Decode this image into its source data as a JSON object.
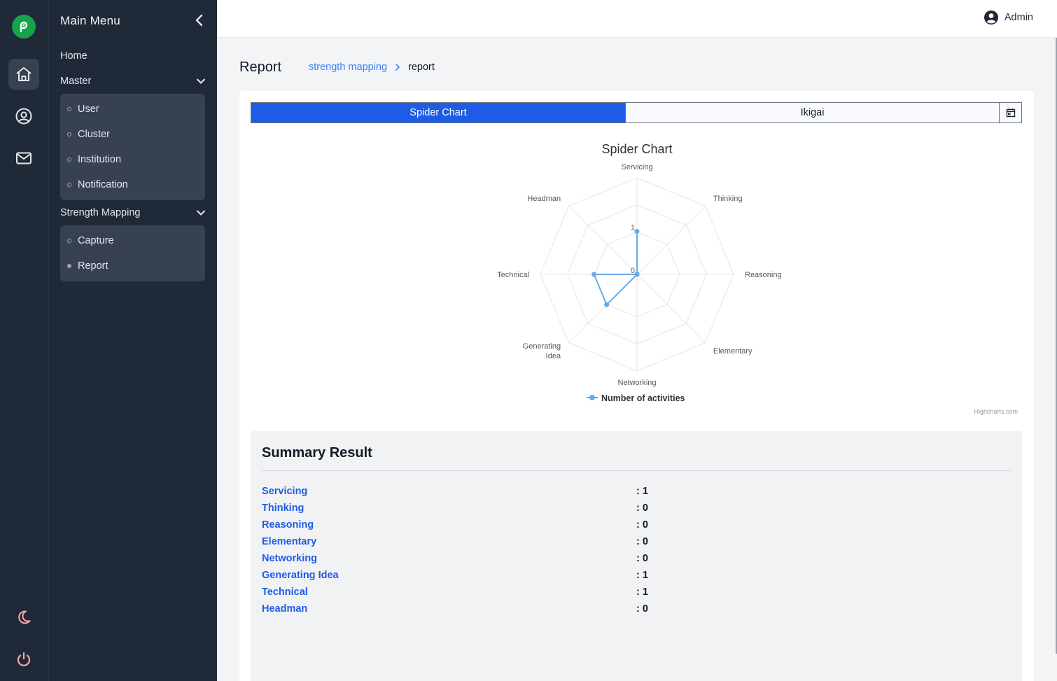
{
  "menu": {
    "title": "Main Menu",
    "home": "Home",
    "master": "Master",
    "master_items": [
      "User",
      "Cluster",
      "Institution",
      "Notification"
    ],
    "strength_mapping": "Strength Mapping",
    "strength_items": [
      "Capture",
      "Report"
    ],
    "active_item": "Report"
  },
  "topbar": {
    "user": "Admin"
  },
  "page": {
    "title": "Report",
    "breadcrumb_link": "strength mapping",
    "breadcrumb_current": "report"
  },
  "tabs": {
    "spider": "Spider Chart",
    "ikigai": "Ikigai",
    "active": "Spider Chart"
  },
  "chart_data": {
    "type": "radar",
    "title": "Spider Chart",
    "categories": [
      "Servicing",
      "Thinking",
      "Reasoning",
      "Elementary",
      "Networking",
      "Generating Idea",
      "Technical",
      "Headman"
    ],
    "series": [
      {
        "name": "Number of activities",
        "values": [
          1,
          0,
          0,
          0,
          0,
          1,
          1,
          0
        ],
        "color": "#6aaae8"
      }
    ],
    "radial_ticks": [
      "0",
      "1"
    ],
    "legend": "bottom-center",
    "credits": "Highcharts.com"
  },
  "summary": {
    "title": "Summary Result",
    "rows": [
      {
        "label": "Servicing",
        "value": ": 1"
      },
      {
        "label": "Thinking",
        "value": ": 0"
      },
      {
        "label": "Reasoning",
        "value": ": 0"
      },
      {
        "label": "Elementary",
        "value": ": 0"
      },
      {
        "label": "Networking",
        "value": ": 0"
      },
      {
        "label": "Generating Idea",
        "value": ": 1"
      },
      {
        "label": "Technical",
        "value": ": 1"
      },
      {
        "label": "Headman",
        "value": ": 0"
      }
    ]
  },
  "colors": {
    "accent": "#1d5ce6",
    "sidebar": "#1f2937",
    "logo": "#16a34a",
    "series": "#6aaae8",
    "night_icon": "#f9a8a8"
  }
}
